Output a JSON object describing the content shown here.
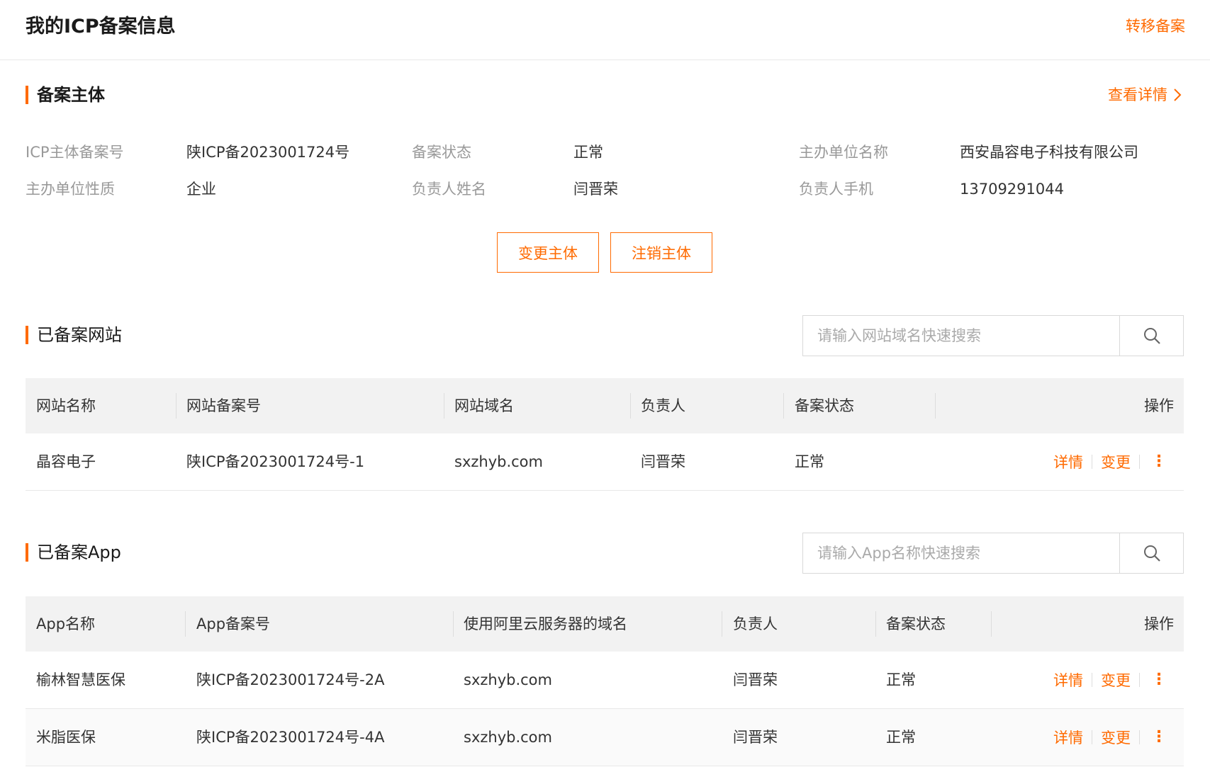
{
  "header": {
    "title": "我的ICP备案信息",
    "transfer_link": "转移备案"
  },
  "entity": {
    "section_title": "备案主体",
    "detail_link": "查看详情",
    "fields": [
      {
        "label": "ICP主体备案号",
        "value": "陕ICP备2023001724号"
      },
      {
        "label": "备案状态",
        "value": "正常"
      },
      {
        "label": "主办单位名称",
        "value": "西安晶容电子科技有限公司"
      },
      {
        "label": "主办单位性质",
        "value": "企业"
      },
      {
        "label": "负责人姓名",
        "value": "闫晋荣"
      },
      {
        "label": "负责人手机",
        "value": "13709291044"
      }
    ],
    "buttons": {
      "change": "变更主体",
      "cancel": "注销主体"
    }
  },
  "websites": {
    "section_title": "已备案网站",
    "search_placeholder": "请输入网站域名快速搜索",
    "columns": [
      "网站名称",
      "网站备案号",
      "网站域名",
      "负责人",
      "备案状态",
      "操作"
    ],
    "rows": [
      {
        "name": "晶容电子",
        "record_no": "陕ICP备2023001724号-1",
        "domain": "sxzhyb.com",
        "owner": "闫晋荣",
        "status": "正常"
      }
    ]
  },
  "apps": {
    "section_title": "已备案App",
    "search_placeholder": "请输入App名称快速搜索",
    "columns": [
      "App名称",
      "App备案号",
      "使用阿里云服务器的域名",
      "负责人",
      "备案状态",
      "操作"
    ],
    "rows": [
      {
        "name": "榆林智慧医保",
        "record_no": "陕ICP备2023001724号-2A",
        "domain": "sxzhyb.com",
        "owner": "闫晋荣",
        "status": "正常"
      },
      {
        "name": "米脂医保",
        "record_no": "陕ICP备2023001724号-4A",
        "domain": "sxzhyb.com",
        "owner": "闫晋荣",
        "status": "正常"
      }
    ]
  },
  "row_actions": {
    "detail": "详情",
    "change": "变更",
    "more": "⋮"
  },
  "colors": {
    "accent": "#ff6a00",
    "header_bg": "#f2f2f2"
  },
  "icons": {
    "search": "search-icon",
    "detail_arrow": "chevron-right-icon",
    "more": "more-vertical-icon"
  }
}
